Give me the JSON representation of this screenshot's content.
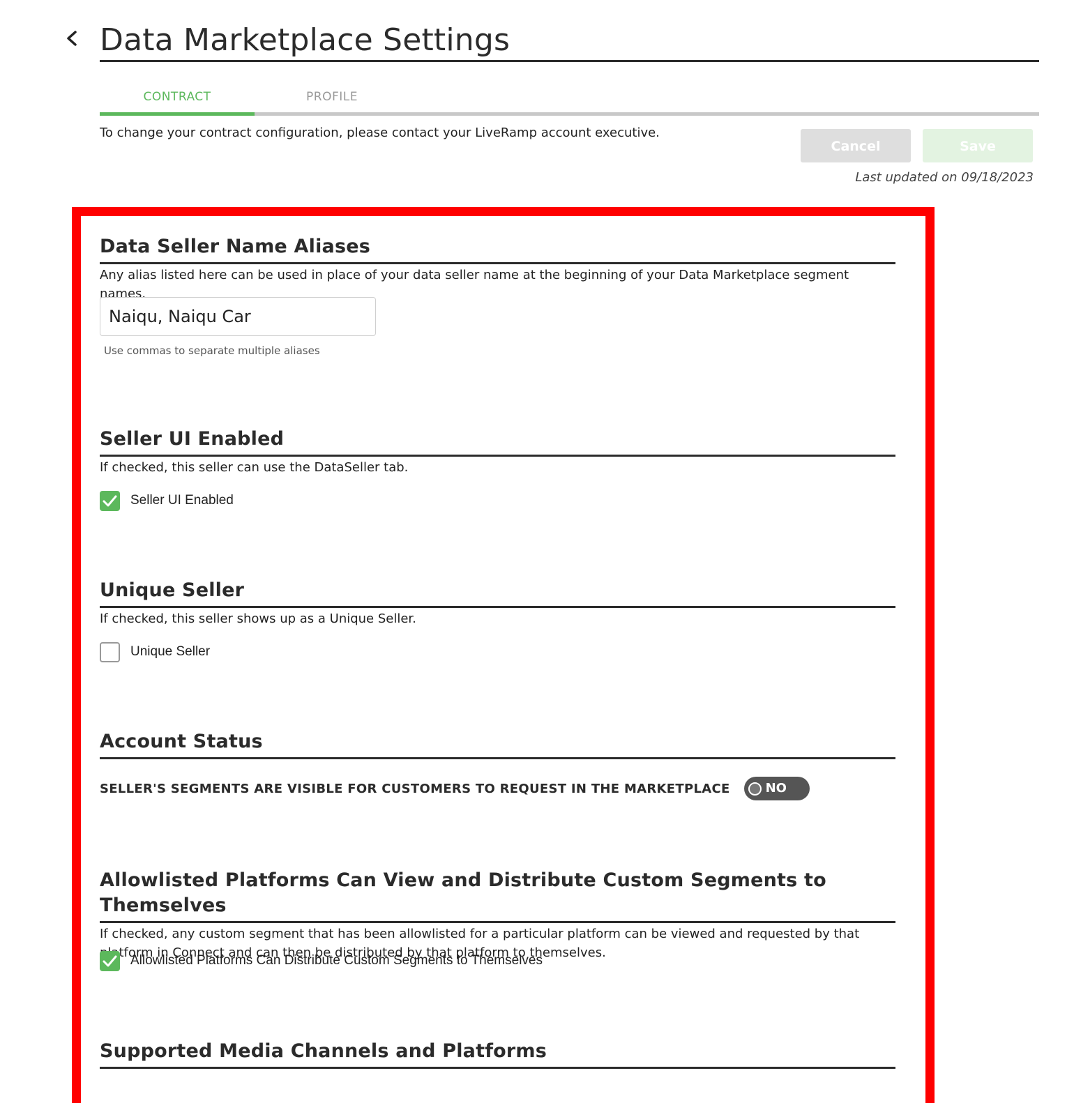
{
  "header": {
    "title": "Data Marketplace Settings"
  },
  "tabs": [
    {
      "label": "CONTRACT",
      "active": true
    },
    {
      "label": "PROFILE",
      "active": false
    }
  ],
  "contact_note": "To change your contract configuration, please contact your LiveRamp account executive.",
  "actions": {
    "cancel_label": "Cancel",
    "save_label": "Save"
  },
  "last_updated": "Last updated on 09/18/2023",
  "colors": {
    "accent": "#5cb85c",
    "highlight": "#ff0000",
    "heading": "#2b2b2b"
  },
  "sections": {
    "aliases": {
      "title": "Data Seller Name Aliases",
      "description": "Any alias listed here can be used in place of your data seller name at the beginning of your Data Marketplace segment names.",
      "input_value": "Naiqu, Naiqu Car",
      "helper": "Use commas to separate multiple aliases"
    },
    "seller_ui": {
      "title": "Seller UI Enabled",
      "description": "If checked, this seller can use the DataSeller tab.",
      "checkbox_label": "Seller UI Enabled",
      "checked": true
    },
    "unique_seller": {
      "title": "Unique Seller",
      "description": "If checked, this seller shows up as a Unique Seller.",
      "checkbox_label": "Unique Seller",
      "checked": false
    },
    "account_status": {
      "title": "Account Status",
      "toggle_label": "SELLER'S SEGMENTS ARE VISIBLE FOR CUSTOMERS TO REQUEST IN THE MARKETPLACE",
      "toggle_value": "NO"
    },
    "allowlisted": {
      "title": "Allowlisted Platforms Can View and Distribute Custom Segments to Themselves",
      "description": "If checked, any custom segment that has been allowlisted for a particular platform can be viewed and requested by that platform in Connect and can then be distributed by that platform to themselves.",
      "checkbox_label": "Allowlisted Platforms Can Distribute Custom Segments to Themselves",
      "checked": true
    },
    "media_channels": {
      "title": "Supported Media Channels and Platforms"
    }
  }
}
